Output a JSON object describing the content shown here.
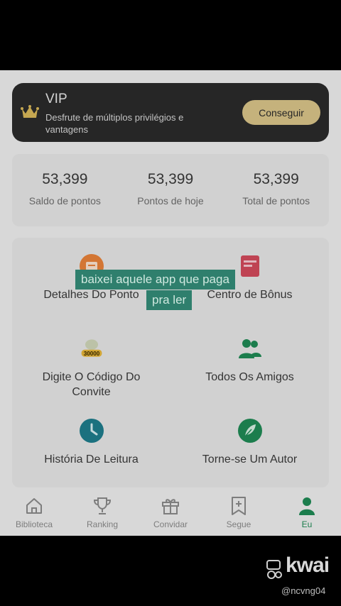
{
  "vip": {
    "title": "VIP",
    "description": "Desfrute de múltiplos privilégios e vantagens",
    "button_label": "Conseguir"
  },
  "points": [
    {
      "value": "53,399",
      "label": "Saldo de pontos"
    },
    {
      "value": "53,399",
      "label": "Pontos de hoje"
    },
    {
      "value": "53,399",
      "label": "Total de pontos"
    }
  ],
  "features": {
    "point_details": {
      "label": "Detalhes Do Ponto"
    },
    "bonus_center": {
      "label": "Centro de Bônus"
    },
    "invite_code": {
      "label": "Digite O Código Do Convite",
      "badge": "30000"
    },
    "all_friends": {
      "label": "Todos Os Amigos"
    },
    "reading_history": {
      "label": "História De Leitura"
    },
    "become_author": {
      "label": "Torne-se Um Autor"
    }
  },
  "nav": [
    {
      "label": "Biblioteca",
      "icon": "home-icon"
    },
    {
      "label": "Ranking",
      "icon": "trophy-icon"
    },
    {
      "label": "Convidar",
      "icon": "gift-icon"
    },
    {
      "label": "Segue",
      "icon": "bookmark-plus-icon"
    },
    {
      "label": "Eu",
      "icon": "user-icon",
      "active": true
    }
  ],
  "caption": {
    "line1": "baixei aquele app que paga",
    "line2": "pra ler"
  },
  "watermark": {
    "brand": "kwai",
    "handle": "@ncvng04"
  },
  "colors": {
    "accent_green": "#1f8a55",
    "vip_gold": "#d9c489",
    "caption_bg": "#2f7f6d"
  }
}
